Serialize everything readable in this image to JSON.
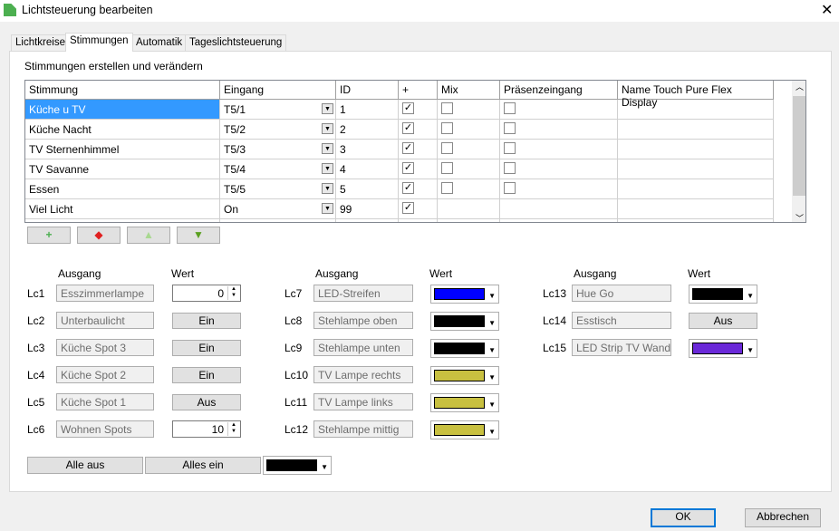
{
  "window": {
    "title": "Lichtsteuerung bearbeiten"
  },
  "tabs": [
    "Lichtkreise",
    "Stimmungen",
    "Automatik",
    "Tageslichtsteuerung"
  ],
  "section_title": "Stimmungen erstellen und verändern",
  "table": {
    "columns": [
      "Stimmung",
      "Eingang",
      "ID",
      "+",
      "Mix",
      "Präsenzeingang",
      "Name Touch Pure Flex Display"
    ],
    "rows": [
      {
        "name": "Küche u TV",
        "eingang": "T5/1",
        "id": "1",
        "plus": true,
        "mix": false,
        "praesenz": false,
        "selected": true
      },
      {
        "name": "Küche Nacht",
        "eingang": "T5/2",
        "id": "2",
        "plus": true,
        "mix": false,
        "praesenz": false
      },
      {
        "name": "TV Sternenhimmel",
        "eingang": "T5/3",
        "id": "3",
        "plus": true,
        "mix": false,
        "praesenz": false
      },
      {
        "name": "TV Savanne",
        "eingang": "T5/4",
        "id": "4",
        "plus": true,
        "mix": false,
        "praesenz": false
      },
      {
        "name": "Essen",
        "eingang": "T5/5",
        "id": "5",
        "plus": true,
        "mix": false,
        "praesenz": false
      },
      {
        "name": "Viel Licht",
        "eingang": "On",
        "id": "99",
        "plus": true,
        "mix": null,
        "praesenz": null
      }
    ]
  },
  "headers": {
    "ausgang": "Ausgang",
    "wert": "Wert"
  },
  "outputs": [
    {
      "lc": "Lc1",
      "name": "Esszimmerlampe",
      "type": "spin",
      "value": "0"
    },
    {
      "lc": "Lc2",
      "name": "Unterbaulicht",
      "type": "button",
      "value": "Ein"
    },
    {
      "lc": "Lc3",
      "name": "Küche Spot 3",
      "type": "button",
      "value": "Ein"
    },
    {
      "lc": "Lc4",
      "name": "Küche Spot 2",
      "type": "button",
      "value": "Ein"
    },
    {
      "lc": "Lc5",
      "name": "Küche Spot 1",
      "type": "button",
      "value": "Aus"
    },
    {
      "lc": "Lc6",
      "name": "Wohnen Spots",
      "type": "spin",
      "value": "10"
    },
    {
      "lc": "Lc7",
      "name": "LED-Streifen",
      "type": "color",
      "color": "#0000ff"
    },
    {
      "lc": "Lc8",
      "name": "Stehlampe oben",
      "type": "color",
      "color": "#000000"
    },
    {
      "lc": "Lc9",
      "name": "Stehlampe unten",
      "type": "color",
      "color": "#000000"
    },
    {
      "lc": "Lc10",
      "name": "TV Lampe rechts",
      "type": "color",
      "color": "#c8c040"
    },
    {
      "lc": "Lc11",
      "name": "TV Lampe links",
      "type": "color",
      "color": "#c8c040"
    },
    {
      "lc": "Lc12",
      "name": "Stehlampe mittig",
      "type": "color",
      "color": "#c8c040"
    },
    {
      "lc": "Lc13",
      "name": "Hue Go",
      "type": "color",
      "color": "#000000"
    },
    {
      "lc": "Lc14",
      "name": "Esstisch",
      "type": "button",
      "value": "Aus"
    },
    {
      "lc": "Lc15",
      "name": "LED Strip TV Wand",
      "type": "color",
      "color": "#6a28d8"
    }
  ],
  "bottom": {
    "all_off": "Alle aus",
    "all_on": "Alles ein",
    "color": "#000000"
  },
  "dialog": {
    "ok": "OK",
    "cancel": "Abbrechen"
  }
}
